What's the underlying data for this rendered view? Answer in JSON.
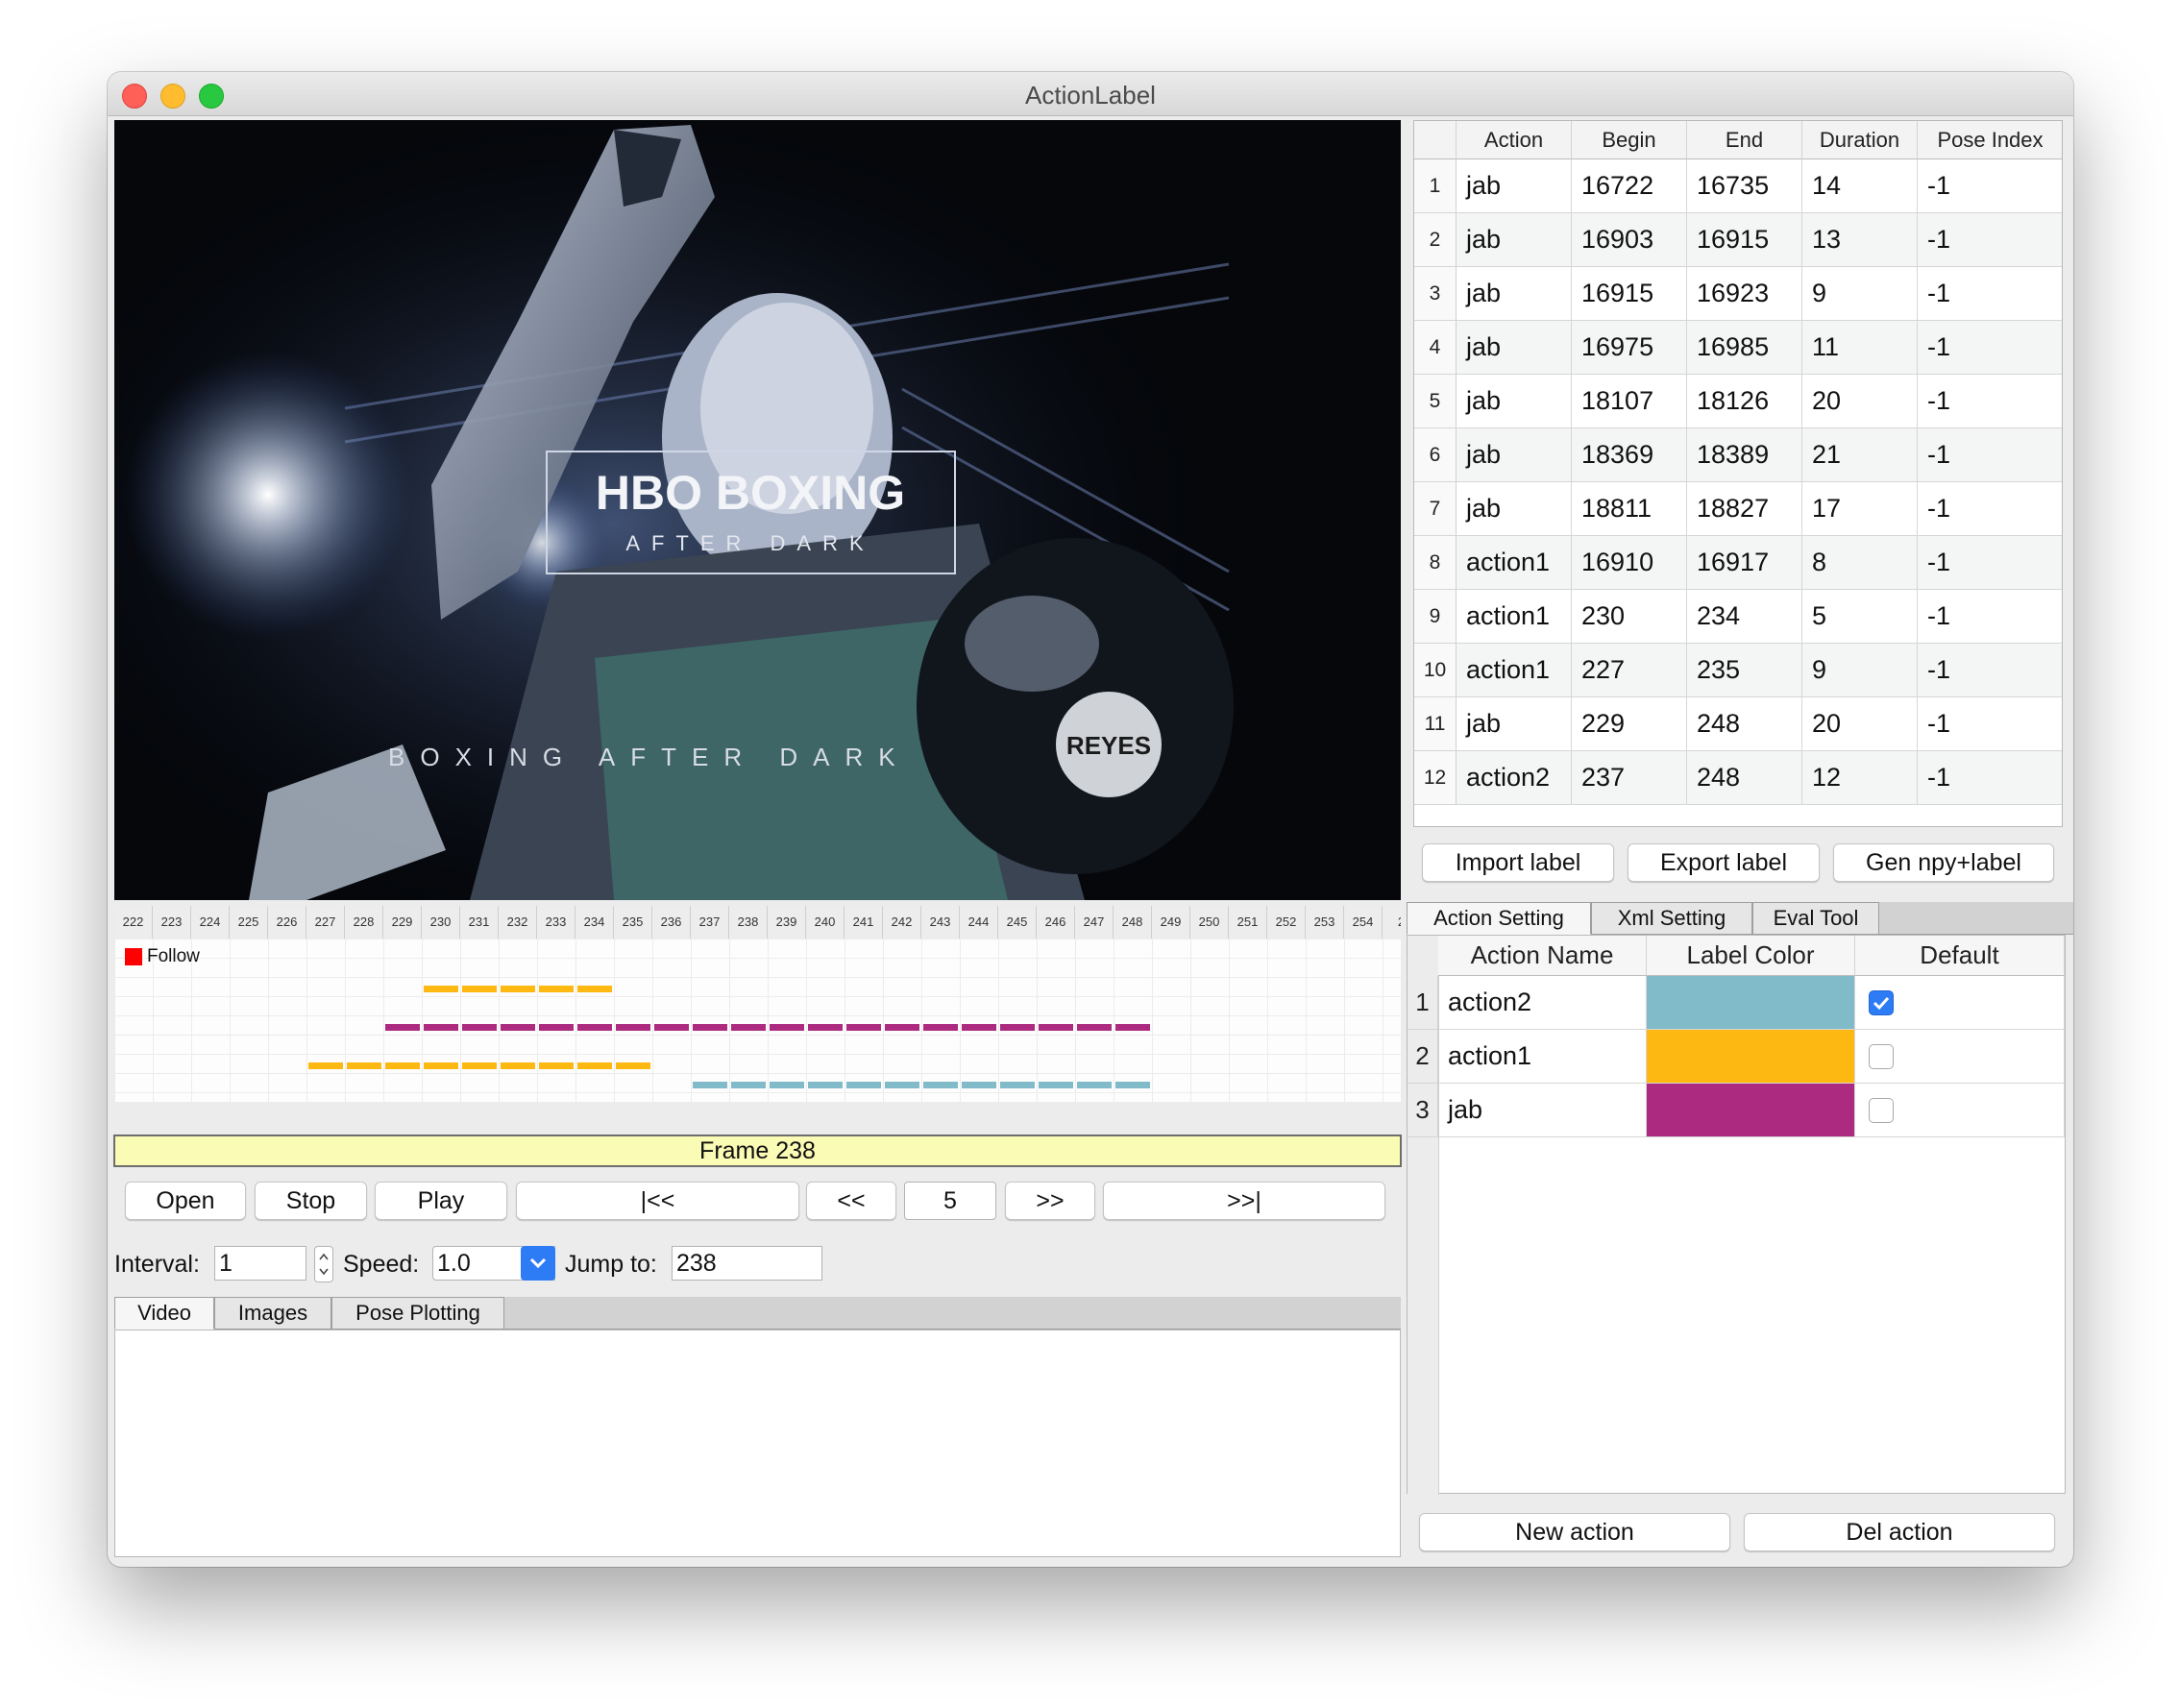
{
  "window": {
    "title": "ActionLabel"
  },
  "video": {
    "logo_main": "HBO BOXING",
    "logo_sub": "AFTER DARK",
    "overlay_text": "BOXING AFTER DARK",
    "glove_text": "REYES"
  },
  "ruler": {
    "frames": [
      "222",
      "223",
      "224",
      "225",
      "226",
      "227",
      "228",
      "229",
      "230",
      "231",
      "232",
      "233",
      "234",
      "235",
      "236",
      "237",
      "238",
      "239",
      "240",
      "241",
      "242",
      "243",
      "244",
      "245",
      "246",
      "247",
      "248",
      "249",
      "250",
      "251",
      "252",
      "253",
      "254",
      "2"
    ]
  },
  "timeline": {
    "follow_label": "Follow",
    "follow_color": "#ff0000"
  },
  "frame": {
    "label": "Frame 238"
  },
  "controls": {
    "open": "Open",
    "stop": "Stop",
    "play": "Play",
    "first": "|<<",
    "prev": "<<",
    "step": "5",
    "next": ">>",
    "last": ">>|",
    "interval_label": "Interval:",
    "interval_value": "1",
    "speed_label": "Speed:",
    "speed_value": "1.0",
    "jump_label": "Jump to:",
    "jump_value": "238"
  },
  "bottom_tabs": [
    "Video",
    "Images",
    "Pose Plotting"
  ],
  "label_table": {
    "headers": [
      "Action",
      "Begin",
      "End",
      "Duration",
      "Pose Index"
    ],
    "rows": [
      [
        "1",
        "jab",
        "16722",
        "16735",
        "14",
        "-1"
      ],
      [
        "2",
        "jab",
        "16903",
        "16915",
        "13",
        "-1"
      ],
      [
        "3",
        "jab",
        "16915",
        "16923",
        "9",
        "-1"
      ],
      [
        "4",
        "jab",
        "16975",
        "16985",
        "11",
        "-1"
      ],
      [
        "5",
        "jab",
        "18107",
        "18126",
        "20",
        "-1"
      ],
      [
        "6",
        "jab",
        "18369",
        "18389",
        "21",
        "-1"
      ],
      [
        "7",
        "jab",
        "18811",
        "18827",
        "17",
        "-1"
      ],
      [
        "8",
        "action1",
        "16910",
        "16917",
        "8",
        "-1"
      ],
      [
        "9",
        "action1",
        "230",
        "234",
        "5",
        "-1"
      ],
      [
        "10",
        "action1",
        "227",
        "235",
        "9",
        "-1"
      ],
      [
        "11",
        "jab",
        "229",
        "248",
        "20",
        "-1"
      ],
      [
        "12",
        "action2",
        "237",
        "248",
        "12",
        "-1"
      ]
    ]
  },
  "label_buttons": {
    "import": "Import label",
    "export": "Export label",
    "gen": "Gen npy+label"
  },
  "right_tabs": [
    "Action Setting",
    "Xml Setting",
    "Eval Tool"
  ],
  "action_table": {
    "headers": [
      "Action Name",
      "Label Color",
      "Default"
    ],
    "rows": [
      {
        "num": "1",
        "name": "action2",
        "color": "#81bbc9",
        "checked": true
      },
      {
        "num": "2",
        "name": "action1",
        "color": "#fdb812",
        "checked": false
      },
      {
        "num": "3",
        "name": "jab",
        "color": "#ac2b80",
        "checked": false
      }
    ]
  },
  "action_buttons": {
    "new": "New action",
    "del": "Del action"
  },
  "colors": {
    "jab": "#ac2b80",
    "action1": "#fdb812",
    "action2": "#81bbc9",
    "checkbox_blue": "#2d7cf6",
    "frame_bar": "#fafbb4"
  }
}
